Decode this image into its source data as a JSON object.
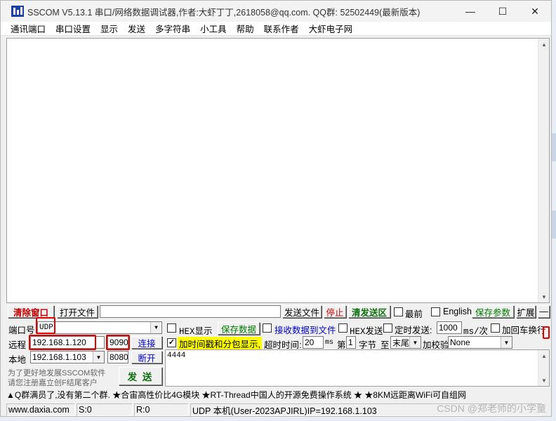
{
  "window": {
    "title": "SSCOM V5.13.1 串口/网络数据调试器,作者:大虾丁丁,2618058@qq.com. QQ群: 52502449(最新版本)",
    "minimize": "—",
    "maximize": "☐",
    "close": "✕"
  },
  "menu": [
    "通讯端口",
    "串口设置",
    "显示",
    "发送",
    "多字符串",
    "小工具",
    "帮助",
    "联系作者",
    "大虾电子网"
  ],
  "toolbar": {
    "clear_window": "清除窗口",
    "open_file": "打开文件",
    "file_path": "",
    "send_file": "发送文件",
    "stop": "停止",
    "clear_send": "清发送区",
    "topmost": "最前",
    "english": "English",
    "save_params": "保存参数",
    "expand": "扩展",
    "collapse": "—"
  },
  "port": {
    "label": "端口号",
    "value": "UDP"
  },
  "remote": {
    "label": "远程",
    "ip": "192.168.1.120",
    "port": "9090",
    "connect": "连接"
  },
  "local": {
    "label": "本地",
    "ip": "192.168.1.103",
    "port": "8080",
    "disconnect": "断开"
  },
  "options": {
    "hex_display": "HEX显示",
    "save_data": "保存数据",
    "recv_to_file": "接收数据到文件",
    "hex_send": "HEX发送",
    "timed_send": "定时发送:",
    "interval": "1000",
    "interval_unit": "ms/次",
    "add_crlf": "加回车换行",
    "timestamp": "加时间戳和分包显示,",
    "timeout_label": "超时时间:",
    "timeout": "20",
    "timeout_unit": "ms",
    "byte_prefix": "第",
    "byte_index": "1",
    "byte_unit": "字节",
    "to_label": "至",
    "to_value": "末尾",
    "checksum_label": "加校验",
    "checksum": "None"
  },
  "send": {
    "content": "4444",
    "send_button": "发 送"
  },
  "ad": {
    "line1": "为了更好地发展SSCOM软件",
    "line2": "请您注册嘉立创F结尾客户"
  },
  "banner": "▲Q群满员了,没有第二个群. ★合宙高性价比4G模块 ★RT-Thread中国人的开源免费操作系统 ★ ★8KM远距离WiFi可自组网",
  "status": {
    "site": "www.daxia.com",
    "sent": "S:0",
    "received": "R:0",
    "info": "UDP 本机(User-2023APJIRL)IP=192.168.1.103"
  },
  "watermark": "CSDN @郑老师的小学童",
  "colors": {
    "accent_red": "#e00000",
    "timestamp_highlight": "#ffff00"
  }
}
